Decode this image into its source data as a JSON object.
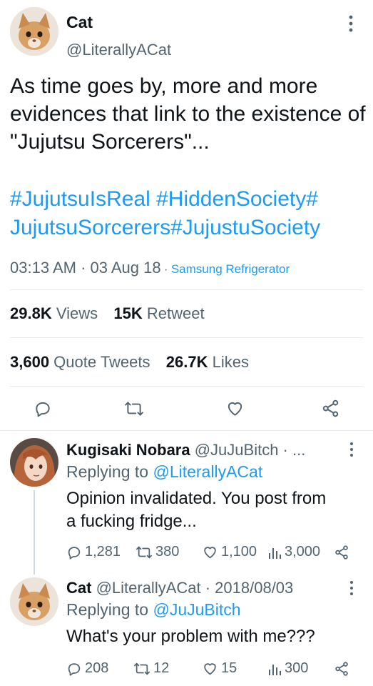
{
  "tweet": {
    "author_name": "Cat",
    "author_handle": "@LiterallyACat",
    "text": "As time goes by, more and more evidences that link to the existence of \"Jujutsu Sorcerers\"...",
    "hashtags_line1": "#JujutsuIsReal #HiddenSociety#",
    "hashtags_line2": "JujutsuSorcerers#JujustuSociety",
    "time": "03:13 AM · 03 Aug 18",
    "source_sep": " · ",
    "source": "Samsung Refrigerator",
    "views_count": "29.8K",
    "views_label": " Views",
    "retweet_count": "15K",
    "retweet_label": " Retweet",
    "quote_count": "3,600",
    "quote_label": " Quote Tweets",
    "likes_count": "26.7K",
    "likes_label": " Likes"
  },
  "replies": [
    {
      "name": "Kugisaki Nobara",
      "meta": " @JuJuBitch · ...",
      "replying_prefix": "Replying to ",
      "replying_to": "@LiterallyACat",
      "text_line1": "Opinion invalidated. You post from",
      "text_line2": "a fucking fridge...",
      "replies": "1,281",
      "retweets": "380",
      "likes": "1,100",
      "views": "3,000"
    },
    {
      "name": "Cat",
      "meta": " @LiterallyACat · 2018/08/03",
      "replying_prefix": "Replying to ",
      "replying_to": "@JuJuBitch",
      "text_line1": "What's your problem with me???",
      "replies": "208",
      "retweets": "12",
      "likes": "15",
      "views": "300"
    }
  ],
  "icons": {
    "more": "more-vertical-icon",
    "reply": "reply-icon",
    "retweet": "retweet-icon",
    "like": "heart-icon",
    "share": "share-icon",
    "views": "views-icon"
  },
  "colors": {
    "link": "#1d9bf0",
    "muted": "#536471",
    "text": "#0f1419",
    "divider": "#e6ecf0"
  }
}
